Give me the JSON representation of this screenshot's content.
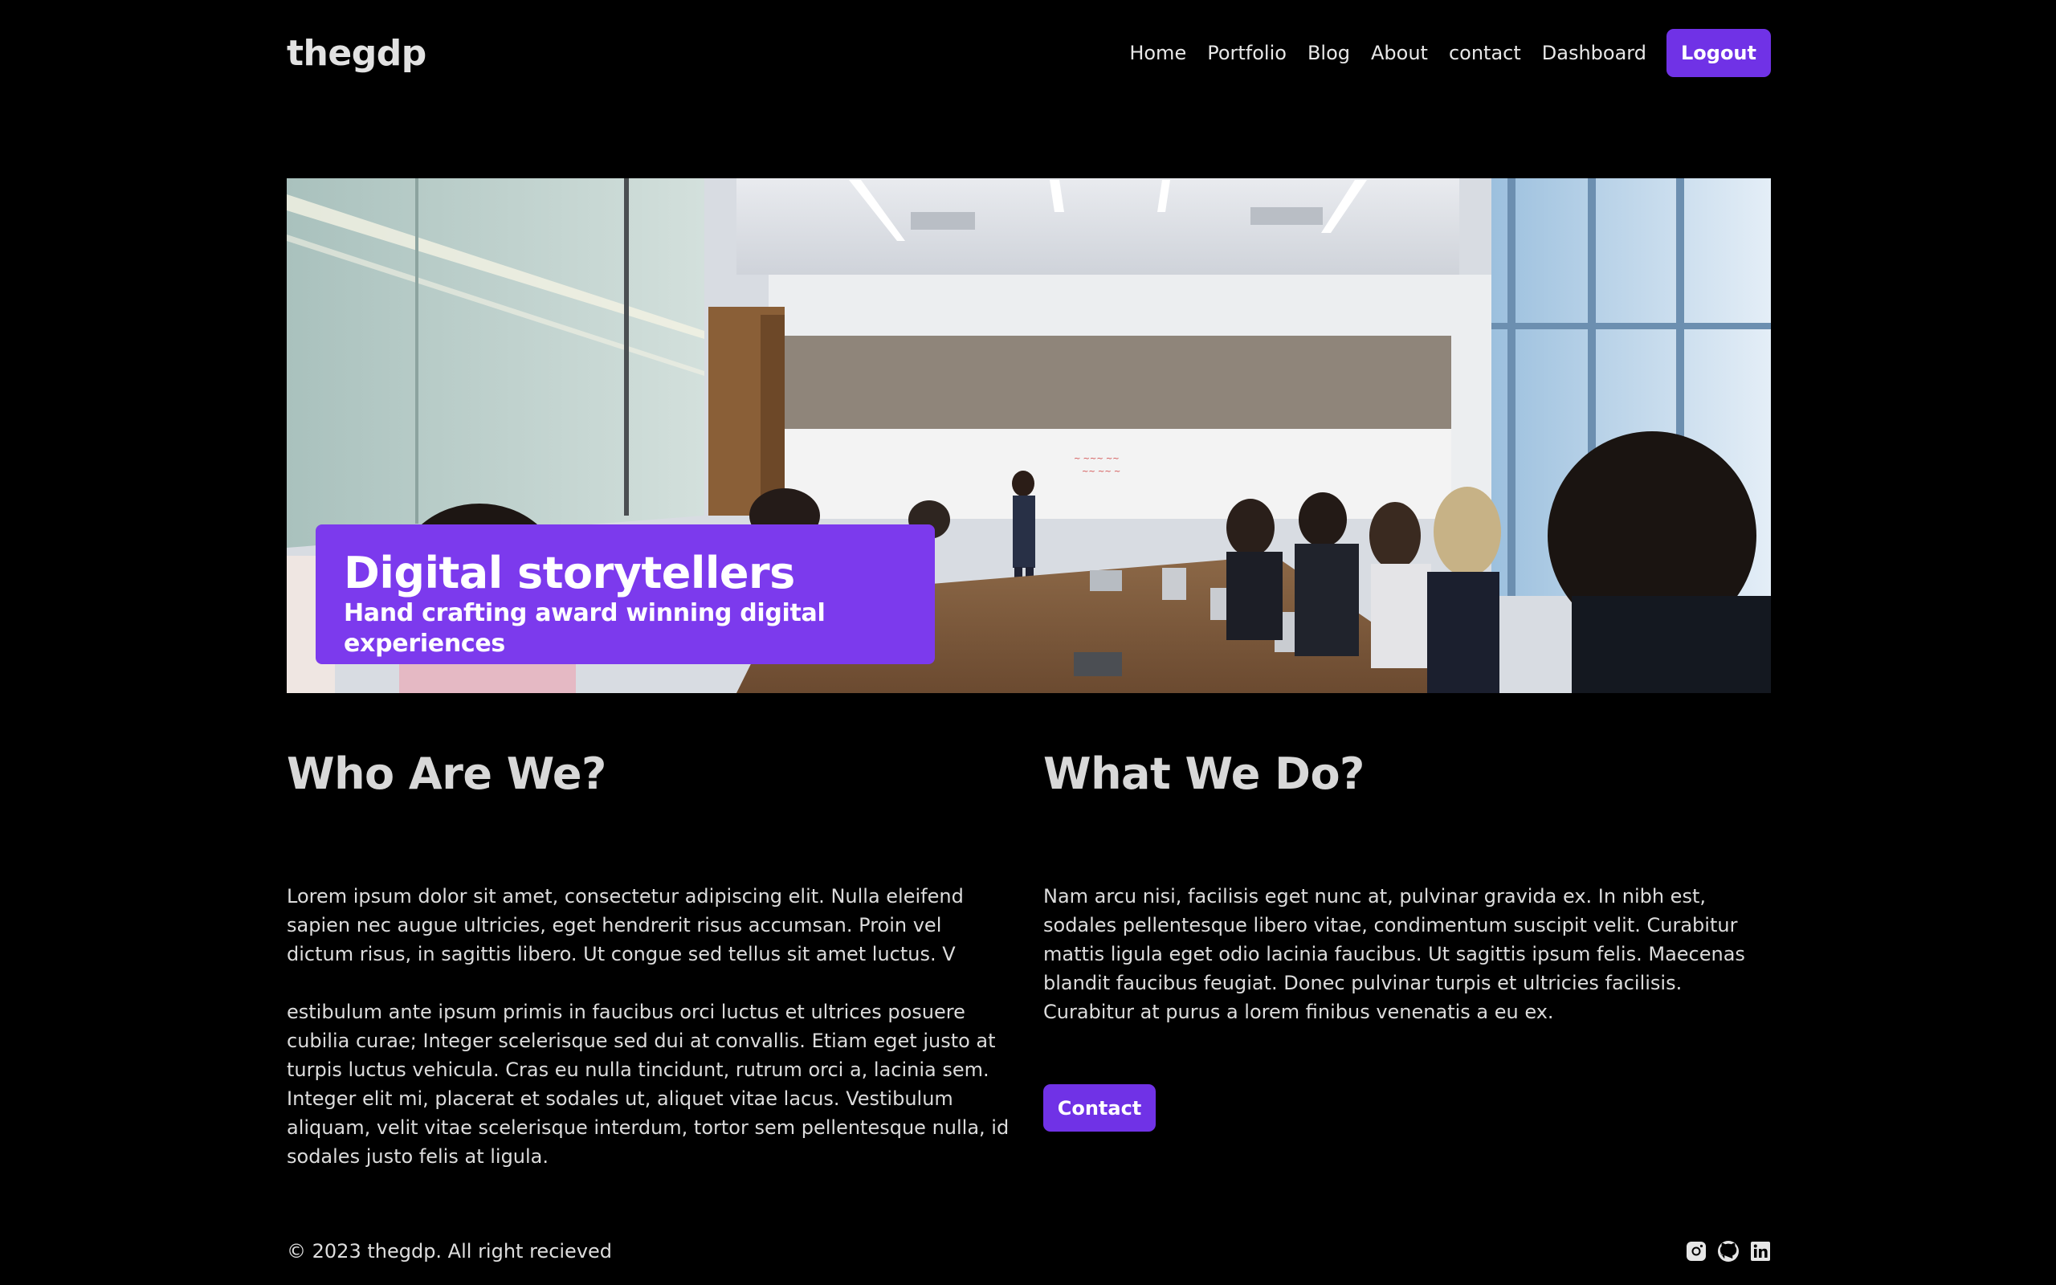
{
  "brand": {
    "name": "thegdp"
  },
  "nav": {
    "items": [
      "Home",
      "Portfolio",
      "Blog",
      "About",
      "contact",
      "Dashboard"
    ],
    "logout_label": "Logout"
  },
  "hero": {
    "title": "Digital storytellers",
    "subtitle": "Hand crafting award winning digital experiences"
  },
  "who": {
    "heading": "Who Are We?",
    "paragraph1": "Lorem ipsum dolor sit amet, consectetur adipiscing elit. Nulla eleifend sapien nec augue ultricies, eget hendrerit risus accumsan. Proin vel dictum risus, in sagittis libero. Ut congue sed tellus sit amet luctus. V",
    "paragraph2": "estibulum ante ipsum primis in faucibus orci luctus et ultrices posuere cubilia curae; Integer scelerisque sed dui at convallis. Etiam eget justo at turpis luctus vehicula. Cras eu nulla tincidunt, rutrum orci a, lacinia sem. Integer elit mi, placerat et sodales ut, aliquet vitae lacus. Vestibulum aliquam, velit vitae scelerisque interdum, tortor sem pellentesque nulla, id sodales justo felis at ligula."
  },
  "what": {
    "heading": "What We Do?",
    "paragraph": "Nam arcu nisi, facilisis eget nunc at, pulvinar gravida ex. In nibh est, sodales pellentesque libero vitae, condimentum suscipit velit. Curabitur mattis ligula eget odio lacinia faucibus. Ut sagittis ipsum felis. Maecenas blandit faucibus feugiat. Donec pulvinar turpis et ultricies facilisis. Curabitur at purus a lorem finibus venenatis a eu ex.",
    "contact_label": "Contact"
  },
  "footer": {
    "copyright": "© 2023 thegdp. All right recieved",
    "social_icons": [
      "instagram-icon",
      "github-icon",
      "linkedin-icon"
    ]
  },
  "colors": {
    "accent": "#7c3aed",
    "button": "#7032e6",
    "background": "#000000"
  }
}
